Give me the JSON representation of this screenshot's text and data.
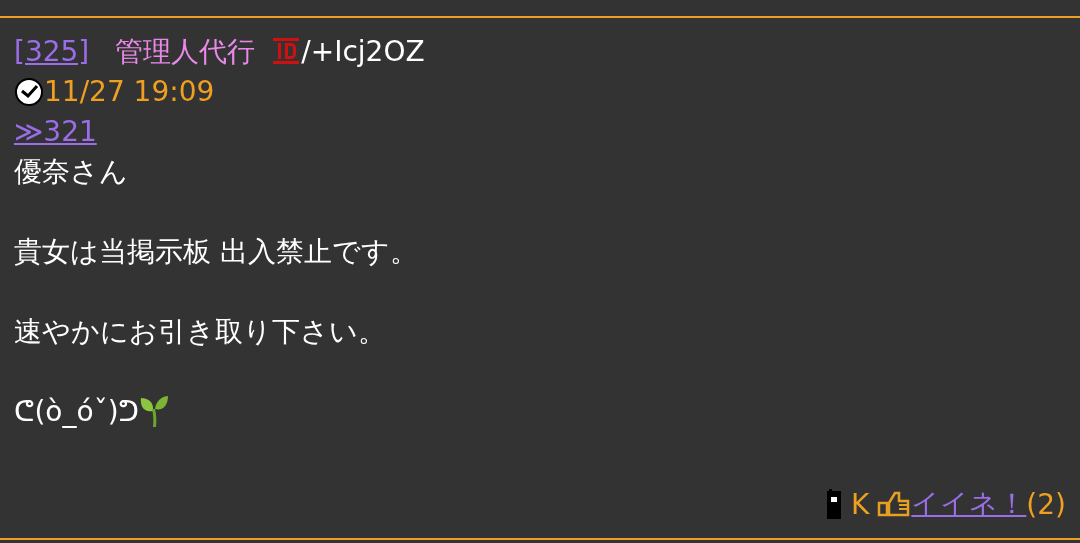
{
  "post": {
    "number": "[325]",
    "name": "管理人代行",
    "id": "/+Icj2OZ",
    "time": "11/27 19:09",
    "reply_link": "≫321",
    "body": [
      "優奈さん",
      "貴女は当掲示板 出入禁止です。",
      "速やかにお引き取り下さい。",
      "ᕦ(ò_óˇ)ᕤ"
    ],
    "footer": {
      "carrier": "K",
      "like_label": "イイネ！",
      "like_count": "(2)"
    }
  }
}
